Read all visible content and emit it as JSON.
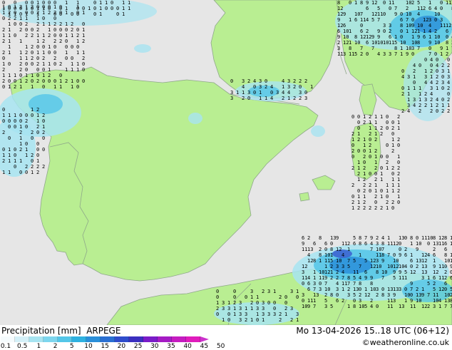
{
  "map": {
    "colors": {
      "sea": "#e6e6e6",
      "land": "#b9ee92",
      "rain_light": "#a7e4f1",
      "rain_medium": "#54c6e8",
      "rain_heavy": "#2a8fd9",
      "rain_intense": "#3b5fd0",
      "border": "#8fa88a"
    },
    "precip_value_glyphs": [
      "0",
      "1",
      "2",
      "3",
      "4",
      "5",
      "6",
      "7",
      "8",
      "9",
      "10",
      "11",
      "12",
      "13"
    ]
  },
  "footer": {
    "title": "Precipitation [mm]  ARPEGE",
    "valid_time": "Mo 13-04-2026 15..18 UTC (06+12)",
    "credit": "©weatheronline.co.uk"
  },
  "legend": {
    "labels": [
      "0.1",
      "0.5",
      "1",
      "2",
      "5",
      "10",
      "15",
      "20",
      "25",
      "30",
      "35",
      "40",
      "45",
      "50"
    ],
    "colors": [
      "#f5fbfd",
      "#d4f0f8",
      "#a7e4f1",
      "#7dd6ee",
      "#54c6e8",
      "#2fb1e0",
      "#2a8fd9",
      "#2a6fd2",
      "#2f4ccb",
      "#3b2fbf",
      "#7a1cc8",
      "#a51cc4",
      "#c51cc0",
      "#e01cbc"
    ],
    "arrow_color": "#cc33cc"
  }
}
